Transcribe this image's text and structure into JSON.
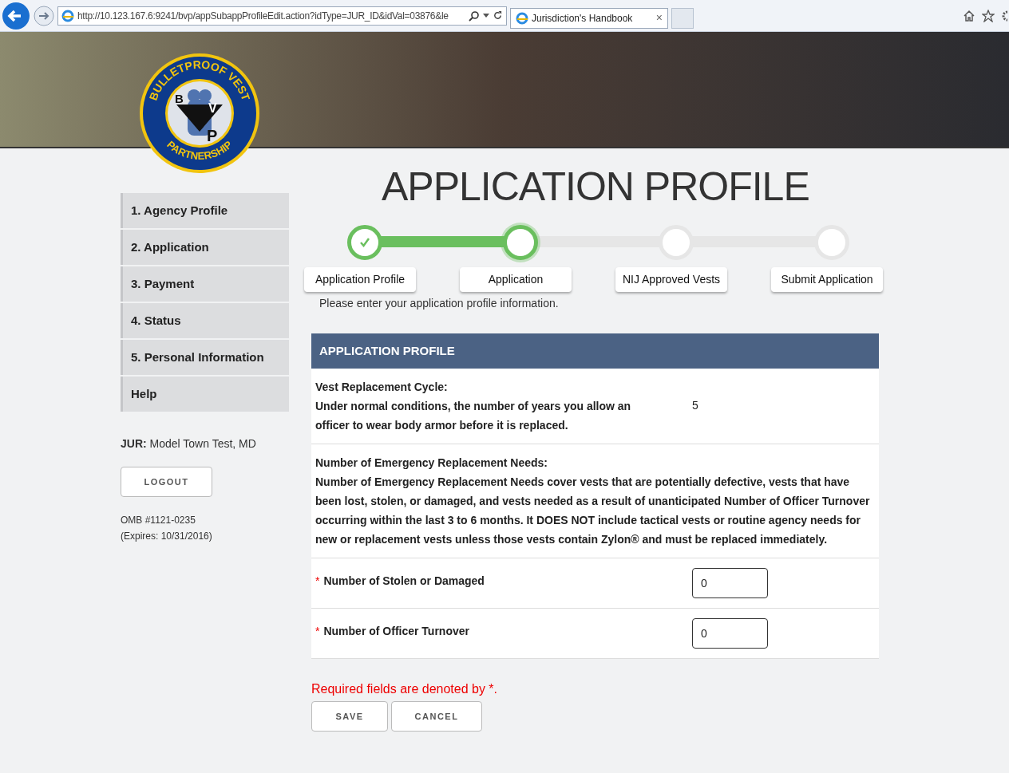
{
  "browser": {
    "address": "http://10.123.167.6:9241/bvp/appSubappProfileEdit.action?idType=JUR_ID&idVal=03876&le",
    "tab_title": "Jurisdiction's Handbook",
    "tab_close": "×"
  },
  "logo": {
    "top_text": "BULLETPROOF VEST",
    "bottom_text": "PARTNERSHIP",
    "letters": [
      "B",
      "V",
      "P"
    ]
  },
  "page_title": "APPLICATION PROFILE",
  "sidebar": {
    "items": [
      {
        "label": "1. Agency Profile",
        "selected": false
      },
      {
        "label": "2. Application",
        "selected": false
      },
      {
        "label": "3. Payment",
        "selected": false
      },
      {
        "label": "4. Status",
        "selected": false
      },
      {
        "label": "5. Personal Information",
        "selected": false
      },
      {
        "label": "Help",
        "selected": false
      }
    ],
    "jur_label": "JUR:",
    "jur_value": "Model Town Test, MD",
    "logout": "LOGOUT",
    "omb": "OMB #1121-0235",
    "expires": "(Expires: 10/31/2016)"
  },
  "steps": [
    {
      "label": "Application Profile",
      "completed": true,
      "current": false
    },
    {
      "label": "Application",
      "completed": false,
      "current": true
    },
    {
      "label": "NIJ Approved Vests",
      "completed": false,
      "current": false
    },
    {
      "label": "Submit Application",
      "completed": false,
      "current": false
    }
  ],
  "intro": "Please enter your application profile information.",
  "panel": {
    "title": "APPLICATION PROFILE",
    "rows": [
      {
        "kind": "value",
        "lines": [
          "Vest Replacement Cycle:",
          "Under normal conditions, the number of years you allow an officer to wear body armor before it is replaced."
        ],
        "value": "5"
      },
      {
        "kind": "text",
        "lines": [
          "Number of Emergency Replacement Needs:",
          "Number of Emergency Replacement Needs cover vests that are potentially defective, vests that have been lost, stolen, or damaged, and vests needed as a result of unanticipated Number of Officer Turnover occurring within the last 3 to 6 months. It DOES NOT include tactical vests or routine agency needs for new or replacement vests unless those vests contain Zylon® and must be replaced immediately."
        ]
      },
      {
        "kind": "input",
        "required_mark": "*",
        "label": "Number of Stolen or Damaged",
        "value": "0"
      },
      {
        "kind": "input",
        "required_mark": "*",
        "label": "Number of Officer Turnover",
        "value": "0"
      }
    ]
  },
  "required_note": "Required fields are denoted by *.",
  "buttons": [
    "SAVE",
    "CANCEL"
  ]
}
